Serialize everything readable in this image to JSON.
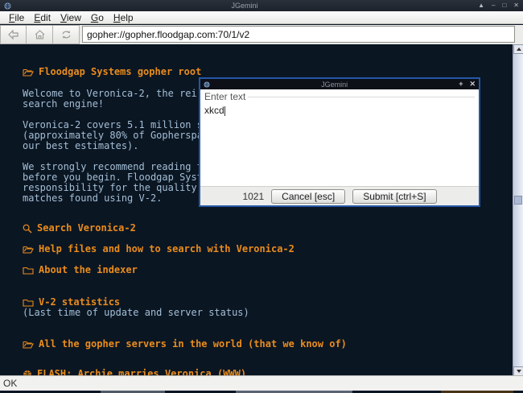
{
  "window": {
    "title": "JGemini",
    "controls": {
      "shade": "▲",
      "minimize": "–",
      "maximize": "□",
      "close": "✕"
    }
  },
  "menu": {
    "items": [
      {
        "mnemonic": "F",
        "rest": "ile"
      },
      {
        "mnemonic": "E",
        "rest": "dit"
      },
      {
        "mnemonic": "V",
        "rest": "iew"
      },
      {
        "mnemonic": "G",
        "rest": "o"
      },
      {
        "mnemonic": "H",
        "rest": "elp"
      }
    ]
  },
  "toolbar": {
    "address": "gopher://gopher.floodgap.com:70/1/v2",
    "buttons": [
      "back",
      "home",
      "refresh"
    ]
  },
  "content": {
    "lines": [
      {
        "icon": "folder-open",
        "kind": "link",
        "text": "Floodgap Systems gopher root"
      },
      {
        "kind": "text",
        "text": "Welcome to Veronica-2, the rei"
      },
      {
        "kind": "text",
        "text": "search engine!"
      },
      {
        "kind": "text",
        "text": "Veronica-2 covers 5.1 million s"
      },
      {
        "kind": "text",
        "text": "(approximately 80% of Gopherspa"
      },
      {
        "kind": "text",
        "text": "our best estimates)."
      },
      {
        "kind": "text",
        "text": "We strongly recommend reading t"
      },
      {
        "kind": "text",
        "text": "before you begin. Floodgap Syst"
      },
      {
        "kind": "text",
        "text": "responsibility for the quality"
      },
      {
        "kind": "text",
        "text": "matches found using V-2."
      },
      {
        "icon": "search",
        "kind": "link",
        "text": "Search Veronica-2"
      },
      {
        "icon": "folder-open",
        "kind": "link",
        "text": "Help files and how to search with Veronica-2"
      },
      {
        "icon": "folder",
        "kind": "link",
        "text": "About the indexer"
      },
      {
        "icon": "folder",
        "kind": "link",
        "text": "V-2 statistics"
      },
      {
        "kind": "text",
        "text": "(Last time of update and server status)"
      },
      {
        "icon": "folder-open",
        "kind": "link",
        "text": "All the gopher servers in the world (that we know of)"
      },
      {
        "icon": "globe",
        "kind": "link",
        "text": "FLASH: Archie marries Veronica (WWW)"
      }
    ]
  },
  "dialog": {
    "title": "JGemini",
    "prompt": "Enter text",
    "input_value": "xkcd",
    "char_count": "1021",
    "cancel_label": "Cancel [esc]",
    "submit_label": "Submit [ctrl+S]",
    "controls": {
      "pin": "+",
      "close": "✕"
    }
  },
  "statusbar": {
    "text": "OK"
  },
  "colors": {
    "content_bg": "#0b1623",
    "link_orange": "#ea8c1c",
    "body_blue": "#a4bfd6",
    "dialog_border": "#2457a7",
    "titlebar_bg": "#20262e"
  }
}
